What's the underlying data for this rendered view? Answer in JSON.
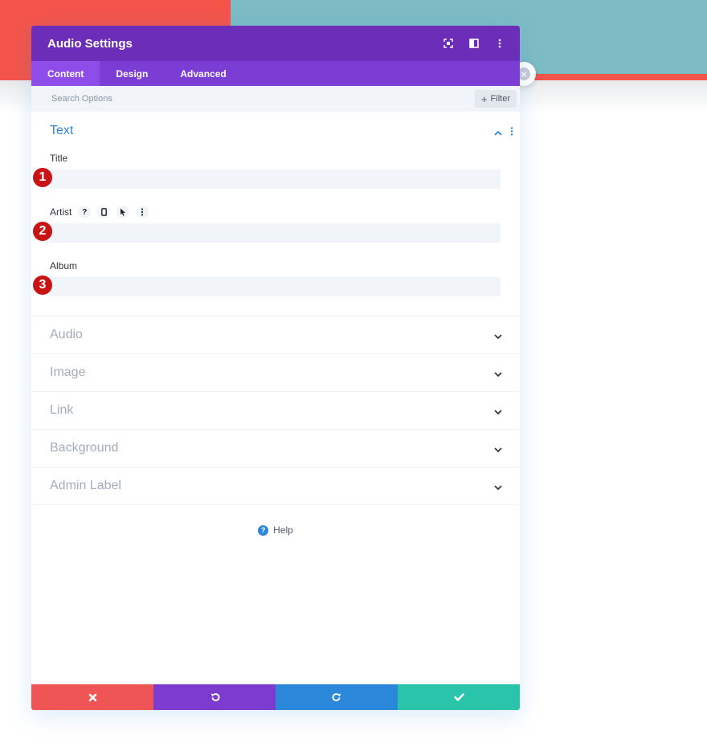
{
  "modal": {
    "title": "Audio Settings"
  },
  "tabs": [
    {
      "label": "Content",
      "active": true
    },
    {
      "label": "Design",
      "active": false
    },
    {
      "label": "Advanced",
      "active": false
    }
  ],
  "search": {
    "placeholder": "Search Options",
    "value": "",
    "filter_label": "Filter"
  },
  "text_section": {
    "title": "Text",
    "fields": [
      {
        "label": "Title",
        "value": "",
        "marker": "1"
      },
      {
        "label": "Artist",
        "value": "",
        "marker": "2"
      },
      {
        "label": "Album",
        "value": "",
        "marker": "3"
      }
    ]
  },
  "collapsed_sections": [
    {
      "title": "Audio"
    },
    {
      "title": "Image"
    },
    {
      "title": "Link"
    },
    {
      "title": "Background"
    },
    {
      "title": "Admin Label"
    }
  ],
  "help": {
    "label": "Help"
  },
  "colors": {
    "header": "#6c2eb9",
    "tabs": "#7b3dd4",
    "tab_active": "#8e4de8",
    "accent_blue": "#2b87da",
    "cancel": "#ef5555",
    "undo": "#7e3bd0",
    "redo": "#2b87da",
    "save": "#29c4a9",
    "marker": "#c81414"
  },
  "icons": {
    "header": [
      "expand-icon",
      "split-view-icon",
      "more-vertical-icon"
    ],
    "field_artist": [
      "help-icon",
      "mobile-icon",
      "pointer-icon",
      "more-vertical-icon"
    ],
    "footer": [
      "close-icon",
      "undo-icon",
      "redo-icon",
      "check-icon"
    ]
  }
}
